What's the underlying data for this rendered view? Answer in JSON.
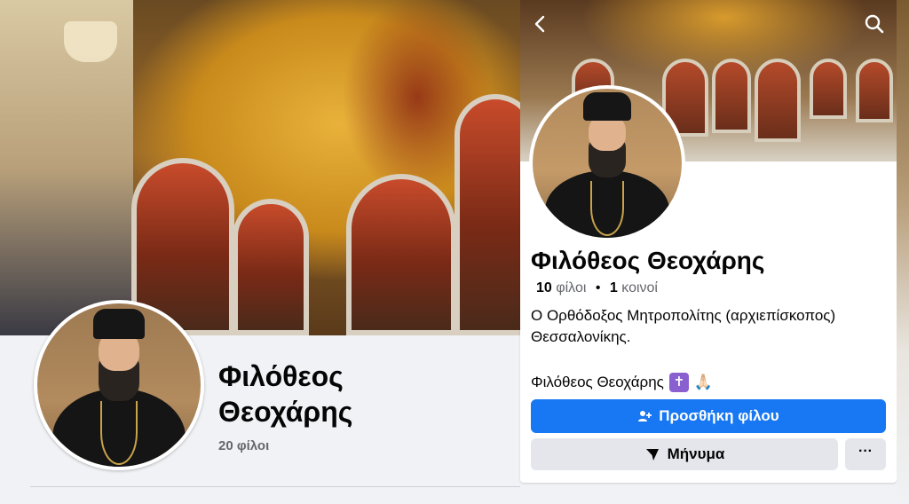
{
  "left_profile": {
    "name_line1": "Φιλόθεος",
    "name_line2": "Θεοχάρης",
    "friends": "20 φίλοι"
  },
  "right_profile": {
    "name": "Φιλόθεος Θεοχάρης",
    "friends_count": "10",
    "friends_word": "φίλοι",
    "separator": "•",
    "mutual_count": "1",
    "mutual_word": "κοινοί",
    "bio": "Ο Ορθόδοξος Μητροπολίτης (αρχιεπίσκοπος) Θεσσαλονίκης.",
    "signature": "Φιλόθεος Θεοχάρης",
    "signature_emoji_1": "✝",
    "signature_emoji_2": "🙏🏻",
    "add_friend_label": "Προσθήκη φίλου",
    "message_label": "Μήνυμα",
    "more_label": "···",
    "back_icon": "chevron-left",
    "search_icon": "search"
  },
  "colors": {
    "primary_button": "#1877f2",
    "secondary_button": "#e4e6eb",
    "muted_text": "#65676b"
  }
}
